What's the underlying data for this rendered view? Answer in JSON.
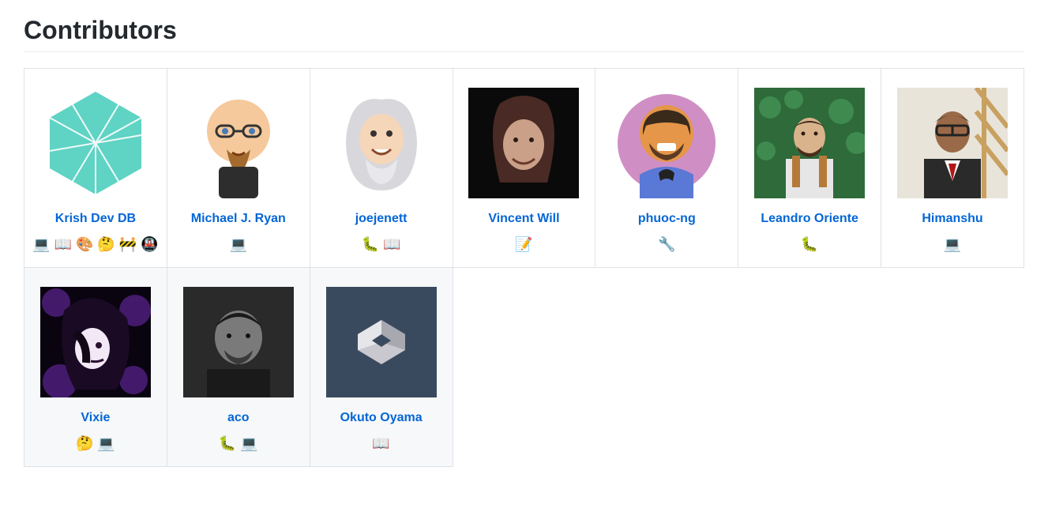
{
  "heading": "Contributors",
  "contributors": [
    {
      "name": "Krish Dev DB",
      "icons": "💻 📖 🎨 🤔 🚧 🚇"
    },
    {
      "name": "Michael J. Ryan",
      "icons": "💻"
    },
    {
      "name": "joejenett",
      "icons": "🐛 📖"
    },
    {
      "name": "Vincent Will",
      "icons": "📝"
    },
    {
      "name": "phuoc-ng",
      "icons": "🔧"
    },
    {
      "name": "Leandro Oriente",
      "icons": "🐛"
    },
    {
      "name": "Himanshu",
      "icons": "💻"
    },
    {
      "name": "Vixie",
      "icons": "🤔 💻"
    },
    {
      "name": "aco",
      "icons": "🐛 💻"
    },
    {
      "name": "Okuto Oyama",
      "icons": "📖"
    }
  ]
}
